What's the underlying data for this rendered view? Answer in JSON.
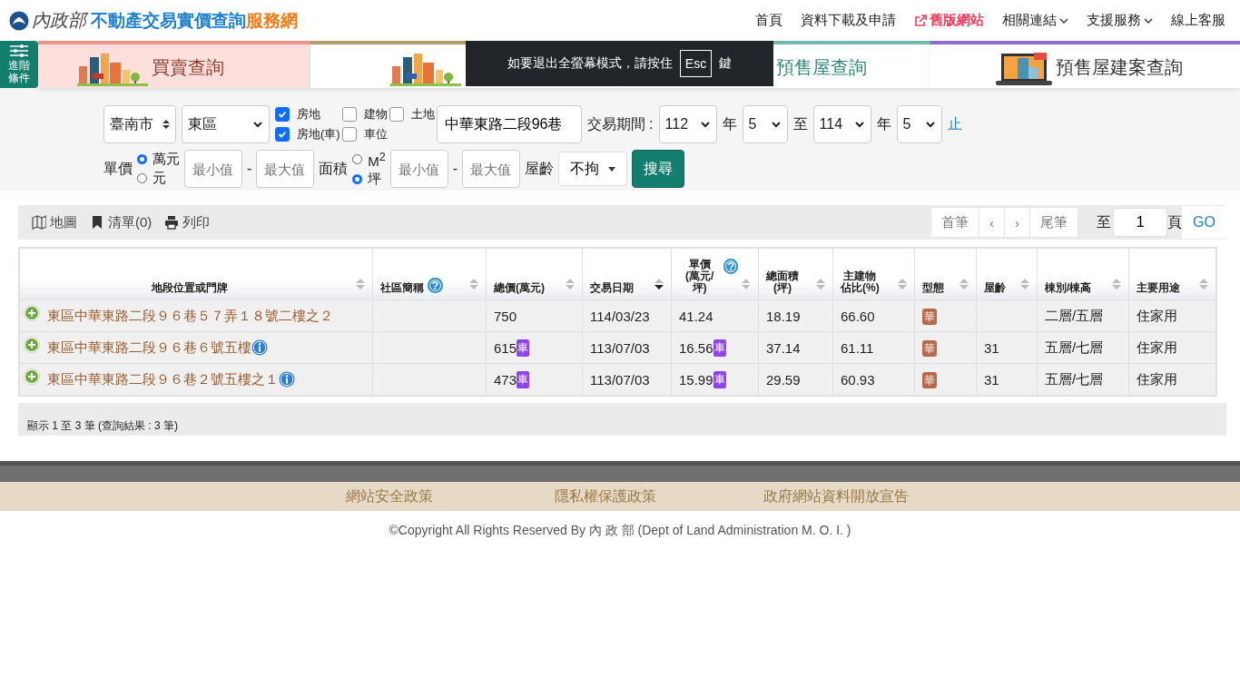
{
  "header": {
    "ministry": "內政部",
    "title": "不動產交易實價查詢",
    "title_accent": "服務網",
    "nav": [
      {
        "label": "首頁",
        "kind": "plain"
      },
      {
        "label": "資料下載及申請",
        "kind": "plain"
      },
      {
        "label": "舊版網站",
        "kind": "external"
      },
      {
        "label": "相關連結",
        "kind": "dropdown"
      },
      {
        "label": "支援服務",
        "kind": "dropdown"
      },
      {
        "label": "線上客服",
        "kind": "plain"
      }
    ]
  },
  "advanced_button": {
    "label": "進階條件"
  },
  "tabs": [
    {
      "label": "買賣查詢",
      "color": "#e9958a",
      "selected": true
    },
    {
      "color": "#b99b72",
      "selected": false
    },
    {
      "label": "預售屋查詢",
      "color": "#74b8ad",
      "selected": false
    },
    {
      "label": "預售屋建案查詢",
      "color": "#8e6ccf",
      "selected": false
    }
  ],
  "fullscreen_notice": {
    "text": "如要退出全螢幕模式，請按住",
    "key": "Esc",
    "suffix": "鍵"
  },
  "filters": {
    "city": "臺南市",
    "district": "東區",
    "checkboxes": [
      {
        "label": "房地",
        "checked": true
      },
      {
        "label": "建物",
        "checked": false
      },
      {
        "label": "土地",
        "checked": false
      },
      {
        "label": "房地(車)",
        "checked": true
      },
      {
        "label": "車位",
        "checked": false
      }
    ],
    "address": "中華東路二段96巷",
    "period_label": "交易期間 :",
    "from_year": "112",
    "year_unit_1": "年",
    "from_month": "5",
    "to": "至",
    "to_year": "114",
    "year_unit_2": "年",
    "to_month": "5",
    "end": "止",
    "price_label": "單價",
    "price_units": [
      {
        "label": "萬元",
        "selected": true
      },
      {
        "label": "元",
        "selected": false
      }
    ],
    "price_min": {
      "placeholder": "最小值"
    },
    "price_dash": "-",
    "price_max": {
      "placeholder": "最大值"
    },
    "area_label": "面積",
    "area_units": [
      {
        "label": "M$^{2}$",
        "selected": false
      },
      {
        "label": "坪",
        "selected": true
      }
    ],
    "area_min": {
      "placeholder": "最小值"
    },
    "area_dash": "-",
    "area_max": {
      "placeholder": "最大值"
    },
    "age_label": "屋齡",
    "age": "不拘",
    "search": "搜尋"
  },
  "toolbar": {
    "items": [
      {
        "label": "地圖"
      },
      {
        "label": "清單(0)"
      },
      {
        "label": "列印"
      }
    ],
    "pager": [
      "首筆",
      "‹",
      "›",
      "尾筆"
    ],
    "goto_label": "至",
    "page": "1",
    "page_unit": "頁",
    "go": "GO"
  },
  "table": {
    "columns": [
      {
        "lines": [
          "地段位置或門牌"
        ],
        "sorted": false
      },
      {
        "lines": [
          "社區簡稱"
        ],
        "help": "?",
        "sorted": false
      },
      {
        "lines": [
          "總價(萬元)"
        ],
        "sorted": false
      },
      {
        "lines": [
          "交易日期"
        ],
        "sorted": true
      },
      {
        "lines": [
          "單價",
          "(萬元/坪)"
        ],
        "help": "?",
        "sorted": false
      },
      {
        "lines": [
          "總面積",
          "(坪)"
        ],
        "sorted": false
      },
      {
        "lines": [
          "主建物",
          "佔比(%)"
        ],
        "sorted": false
      },
      {
        "lines": [
          "型態"
        ],
        "sorted": false
      },
      {
        "lines": [
          "屋齡"
        ],
        "sorted": false
      },
      {
        "lines": [
          "棟別/棟高"
        ],
        "sorted": false
      },
      {
        "lines": [
          "主要用途"
        ],
        "sorted": false
      }
    ],
    "rows": [
      {
        "address": "東區中華東路二段９６巷５７弄１８號二樓之２",
        "info": false,
        "total": "750",
        "date": "114/03/23",
        "unit": "41.24",
        "area": "18.19",
        "ratio": "66.60",
        "type": "華",
        "floors": "二層/五層",
        "use": "住家用"
      },
      {
        "address": "東區中華東路二段９６巷６號五樓",
        "info": true,
        "total": "615",
        "total_badge": "車",
        "date": "113/07/03",
        "unit": "16.56",
        "unit_badge": "車",
        "area": "37.14",
        "ratio": "61.11",
        "type": "華",
        "age": "31",
        "floors": "五層/七層",
        "use": "住家用"
      },
      {
        "address": "東區中華東路二段９６巷２號五樓之１",
        "info": true,
        "total": "473",
        "total_badge": "車",
        "date": "113/07/03",
        "unit": "15.99",
        "unit_badge": "車",
        "area": "29.59",
        "ratio": "60.93",
        "type": "華",
        "age": "31",
        "floors": "五層/七層",
        "use": "住家用"
      }
    ]
  },
  "summary": "顯示 1 至 3 筆 (查詢結果 : 3 筆)",
  "footer": {
    "links": [
      "網站安全政策",
      "隱私權保護政策",
      "政府網站資料開放宣告"
    ],
    "copyright": "©Copyright All Rights Reserved By 內 政 部 (Dept of Land Administration M. O. I. )"
  }
}
